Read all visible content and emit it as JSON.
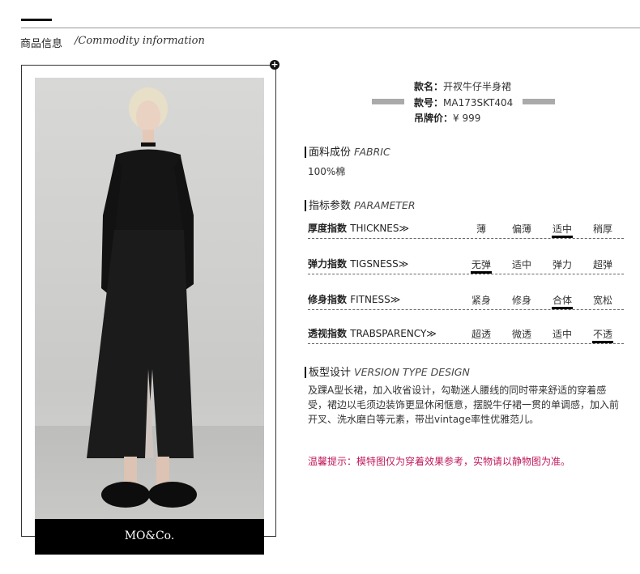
{
  "header": {
    "cn": "商品信息",
    "en": "/Commodity information"
  },
  "brand": "MO&Co.",
  "product": {
    "name_label": "款名：",
    "name_value": "开衩牛仔半身裙",
    "code_label": "款号：",
    "code_value": "MA173SKT404",
    "price_label": "吊牌价：",
    "price_value": "¥ 999"
  },
  "fabric": {
    "title_cn": "面料成份",
    "title_en": "FABRIC",
    "value": "100%棉"
  },
  "parameter": {
    "title_cn": "指标参数",
    "title_en": "PARAMETER",
    "rows": [
      {
        "label_cn": "厚度指数",
        "label_en": "THICKNES≫",
        "options": [
          "薄",
          "偏薄",
          "适中",
          "稍厚"
        ],
        "selected": "适中"
      },
      {
        "label_cn": "弹力指数",
        "label_en": "TIGSNESS≫",
        "options": [
          "无弹",
          "适中",
          "弹力",
          "超弹"
        ],
        "selected": "无弹"
      },
      {
        "label_cn": "修身指数",
        "label_en": "FITNESS≫",
        "options": [
          "紧身",
          "修身",
          "合体",
          "宽松"
        ],
        "selected": "合体"
      },
      {
        "label_cn": "透视指数",
        "label_en": "TRABSPARENCY≫",
        "options": [
          "超透",
          "微透",
          "适中",
          "不透"
        ],
        "selected": "不透"
      }
    ]
  },
  "design": {
    "title_cn": "板型设计",
    "title_en": "VERSION TYPE DESIGN",
    "text": "及踝A型长裙，加入收省设计，勾勒迷人腰线的同时带来舒适的穿着感受，裙边以毛须边装饰更显休闲惬意，摆脱牛仔裙一贯的单调感，加入前开叉、洗水磨白等元素，带出vintage率性优雅范儿。"
  },
  "tip": "温馨提示：模特图仅为穿着效果参考，实物请以静物图为准。",
  "colors": {
    "tip": "#c0185a",
    "accent": "#000000"
  }
}
